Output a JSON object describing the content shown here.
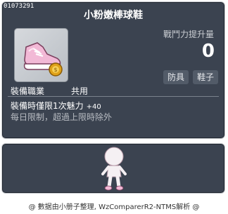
{
  "item": {
    "id": "01073291",
    "name": "小粉嫩棒球鞋",
    "icon": "pink-sneaker-with-gold-coin-icon"
  },
  "stats": {
    "label": "戰鬥力提升量",
    "value": "0"
  },
  "tags": [
    "防具",
    "鞋子"
  ],
  "job": {
    "label": "裝備職業",
    "value": "共用"
  },
  "description": {
    "line1": "裝備時僅限1次魅力",
    "bonus": "+40",
    "line2": "每日限制，超過上限時除外"
  },
  "preview": {
    "icon": "character-mannequin-icon"
  },
  "footer": {
    "text": "@ 數据由小册子整理, WzComparerR2-NTMS解析 @"
  },
  "colors": {
    "panel_bg": "#3b4350",
    "panel_border": "#c9ccd0",
    "text_primary": "#ffffff",
    "text_secondary": "#b8bcc2",
    "tag_bg": "#525b68",
    "shoe_pink": "#f2b9d6",
    "coin_gold": "#e0a21a"
  }
}
